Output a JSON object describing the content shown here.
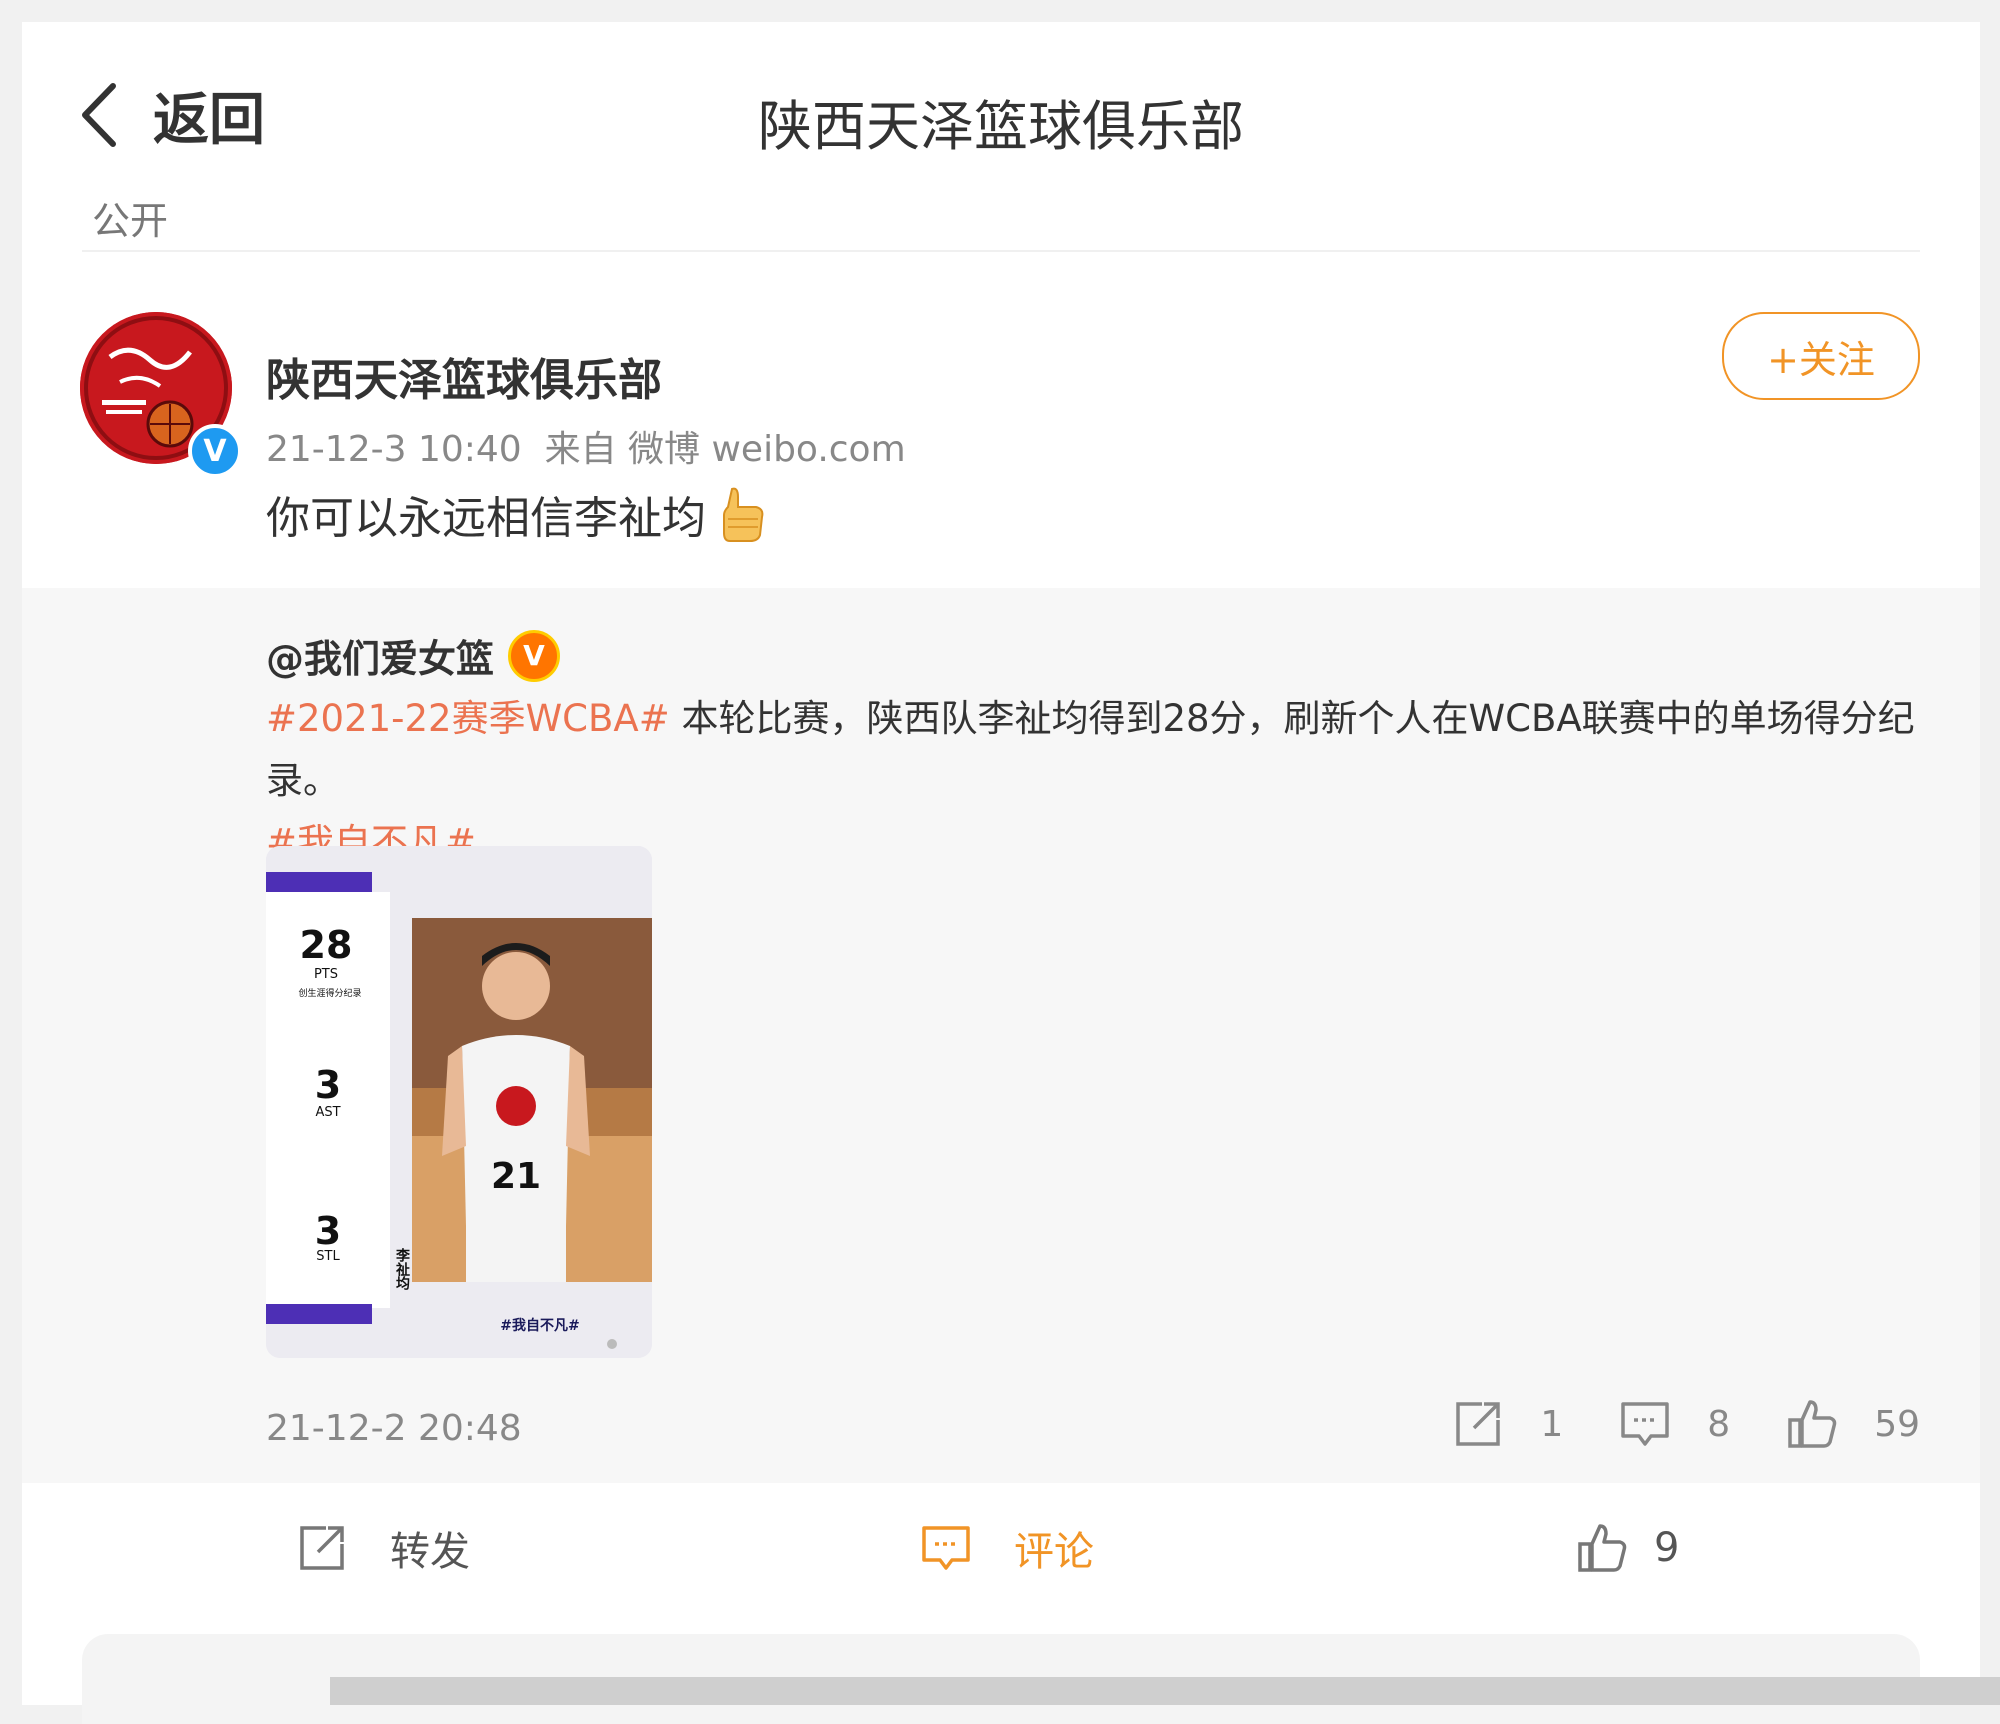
{
  "header": {
    "back_label": "返回",
    "title": "陕西天泽篮球俱乐部"
  },
  "visibility": "公开",
  "post": {
    "author": "陕西天泽篮球俱乐部",
    "timestamp": "21-12-3 10:40",
    "source": "来自 微博 weibo.com",
    "text": "你可以永远相信李祉均",
    "follow_label": "+关注",
    "verified_icon": "blue-v-verified-icon"
  },
  "retweet": {
    "author": "@我们爱女篮",
    "badge_icon": "orange-v-verified-icon",
    "hashtag1": "#2021-22赛季WCBA#",
    "body": " 本轮比赛，陕西队李祉均得到28分，刷新个人在WCBA联赛中的单场得分纪录。",
    "hashtag2": "#我自不凡#",
    "image": {
      "pts": "28",
      "pts_label": "PTS",
      "pts_note": "创生涯得分纪录",
      "ast": "3",
      "ast_label": "AST",
      "stl": "3",
      "stl_label": "STL",
      "jersey": "21",
      "name_vertical": "李祉均",
      "footer_tag": "#我自不凡#"
    },
    "timestamp": "21-12-2 20:48",
    "repost_count": "1",
    "comment_count": "8",
    "like_count": "59"
  },
  "bottom_bar": {
    "repost_label": "转发",
    "comment_label": "评论",
    "like_count": "9"
  },
  "colors": {
    "accent": "#f19426",
    "hashtag": "#eb7350",
    "verified_blue": "#1e9af1",
    "brand_red": "#c8181e"
  }
}
